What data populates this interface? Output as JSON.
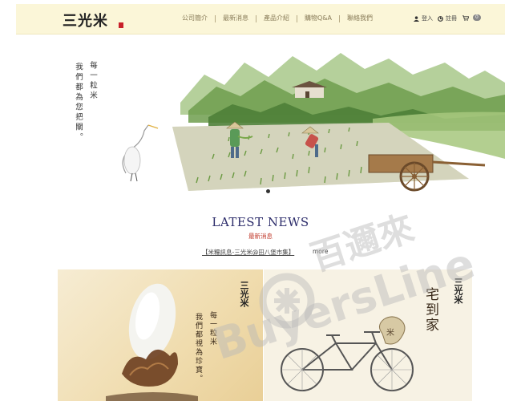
{
  "header": {
    "logo_text": "三光米",
    "nav": [
      "公司簡介",
      "最新消息",
      "產品介紹",
      "購物Q&A",
      "聯絡我們"
    ],
    "login_label": "登入",
    "register_label": "註冊",
    "cart_count": "0"
  },
  "hero": {
    "line1": "每一粒米",
    "line2": "我們都為您把關。"
  },
  "news": {
    "title": "LATEST NEWS",
    "subtitle": "最新消息",
    "item": "【米糧訊息-三光米@田八堡市集】",
    "more": "more"
  },
  "panel_left": {
    "logo_text": "三光米",
    "line1": "每一粒米",
    "line2": "我們都視為珍寶。"
  },
  "panel_right": {
    "logo_text": "三光米",
    "slogan": "宅到家"
  },
  "watermark": {
    "text_cn": "百邇來",
    "text_en": "BuyersLine"
  },
  "colors": {
    "header_bg": "#fbf6d8",
    "news_title": "#2d2d6b",
    "news_sub": "#c0392b",
    "seal_red": "#c8202a"
  }
}
